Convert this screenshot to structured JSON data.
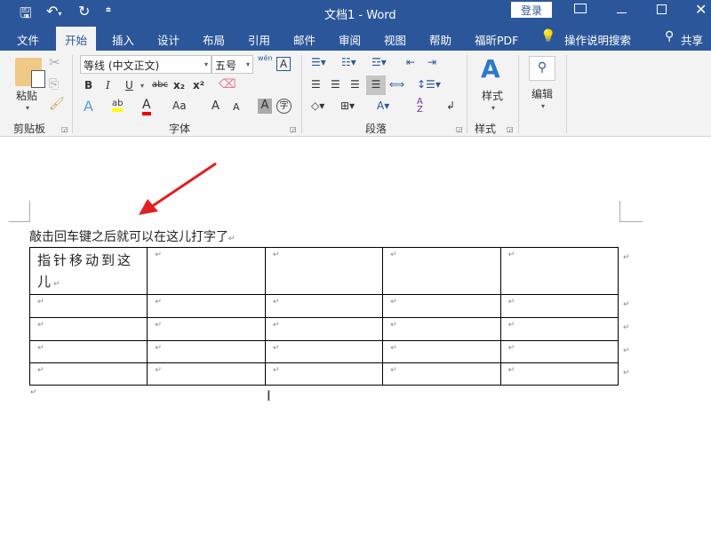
{
  "titlebar": {
    "title": "文档1  -  Word",
    "login": "登录",
    "icons": [
      "save-icon",
      "undo-icon",
      "redo-icon",
      "customize-icon",
      "ribbon-display-icon",
      "minimize-icon",
      "maximize-icon",
      "close-icon"
    ]
  },
  "tabs": [
    "文件",
    "开始",
    "插入",
    "设计",
    "布局",
    "引用",
    "邮件",
    "审阅",
    "视图",
    "帮助",
    "福昕PDF"
  ],
  "search": "操作说明搜索",
  "share": "共享",
  "ribbon": {
    "clipboard": {
      "paste": "粘贴",
      "group": "剪贴板"
    },
    "font": {
      "name": "等线 (中文正文)",
      "size": "五号",
      "bold": "B",
      "italic": "I",
      "underline": "U",
      "strike": "abc",
      "sub": "x₂",
      "sup": "x²",
      "case": "Aa",
      "grow": "A",
      "shrink": "A",
      "shade": "A",
      "enclose": "字",
      "phonetic": "wén",
      "group": "字体"
    },
    "paragraph": {
      "group": "段落"
    },
    "styles": {
      "label": "样式",
      "group": "样式"
    },
    "editing": {
      "label": "编辑"
    }
  },
  "document": {
    "line1": "敲击回车键之后就可以在这儿打字了",
    "cell1": "指针移动到这儿",
    "mark": "↵",
    "rows": 5,
    "cols": 5
  },
  "colors": {
    "accent": "#2b579a",
    "arrow": "#e02020"
  }
}
